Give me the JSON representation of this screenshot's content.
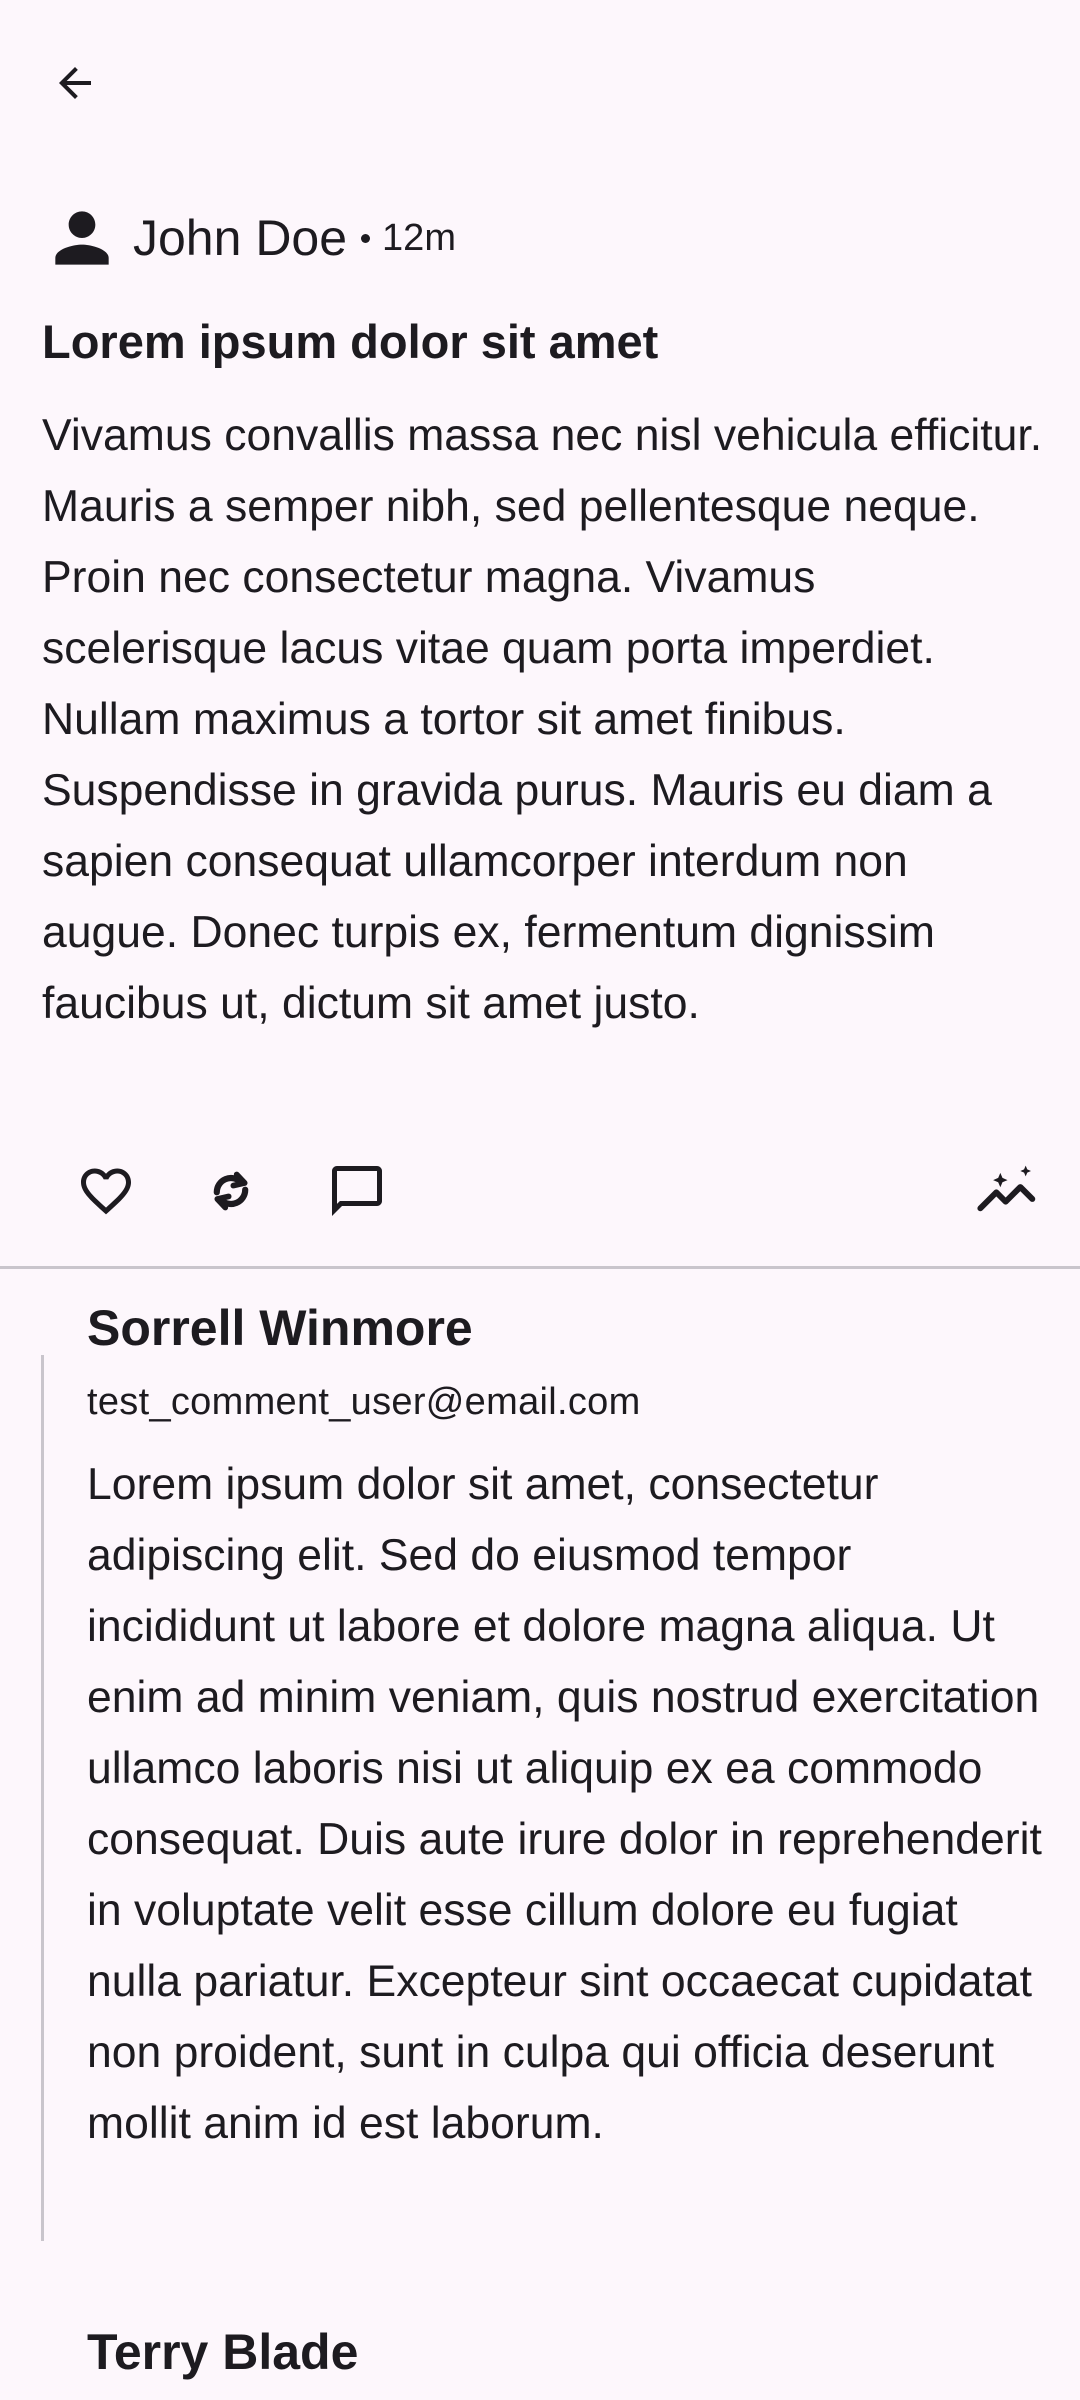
{
  "nav": {
    "back_icon": "arrow-back-icon"
  },
  "post": {
    "author_icon": "person-icon",
    "author": "John Doe",
    "time": "12m",
    "title": "Lorem ipsum dolor sit amet",
    "body": "Vivamus convallis massa nec nisl vehicula efficitur. Mauris a semper nibh, sed pellentesque neque. Proin nec consectetur magna. Vivamus scelerisque lacus vitae quam porta imperdiet. Nullam maximus a tortor sit amet finibus. Suspendisse in gravida purus. Mauris eu diam a sapien consequat ullamcorper interdum non augue. Donec turpis ex, fermentum dignissim faucibus ut, dictum sit amet justo.",
    "actions": [
      {
        "name": "like",
        "icon": "heart-outline-icon"
      },
      {
        "name": "repost",
        "icon": "repost-icon"
      },
      {
        "name": "comment",
        "icon": "comment-icon"
      },
      {
        "name": "insights",
        "icon": "sparkle-trend-icon"
      }
    ]
  },
  "comments": [
    {
      "author": "Sorrell Winmore",
      "email": "test_comment_user@email.com",
      "body": "Lorem ipsum dolor sit amet, consectetur adipiscing elit. Sed do eiusmod tempor incididunt ut labore et dolore magna aliqua. Ut enim ad minim veniam, quis nostrud exercitation ullamco laboris nisi ut aliquip ex ea commodo consequat. Duis aute irure dolor in reprehenderit in voluptate velit esse cillum dolore eu fugiat nulla pariatur. Excepteur sint occaecat cupidatat non proident, sunt in culpa qui officia deserunt mollit anim id est laborum."
    },
    {
      "author": "Terry Blade"
    }
  ],
  "colors": {
    "background": "#FDF7FC",
    "text": "#1D1B20",
    "divider": "#C9C5CC"
  }
}
